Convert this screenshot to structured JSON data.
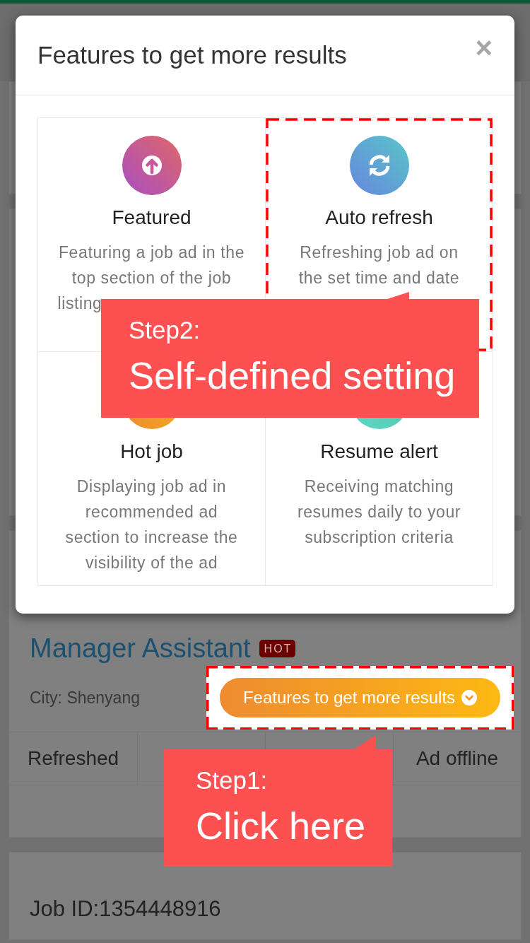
{
  "modal": {
    "title": "Features to get more results",
    "close": "×",
    "features": [
      {
        "title": "Featured",
        "description": "Featuring a job ad in the\ntop section of the job\nlisting",
        "cut_off": true,
        "highlighted": false
      },
      {
        "title": "Auto refresh",
        "description": "Refreshing job ad on\nthe set time and date",
        "cut_off": false,
        "highlighted": true
      },
      {
        "title": "Hot job",
        "description": "Displaying job ad in\nrecommended ad\nsection to increase the\nvisibility of the ad",
        "cut_off": false,
        "highlighted": false
      },
      {
        "title": "Resume alert",
        "description": "Receiving matching\nresumes daily to your\nsubscription criteria",
        "cut_off": false,
        "highlighted": false
      }
    ]
  },
  "job": {
    "title": "Manager Assistant",
    "badge": "HOT",
    "city": "City: Shenyang",
    "features_button": {
      "label": "Features to get more results",
      "highlighted": true
    },
    "actions": [
      {
        "label": "Refreshed"
      },
      {
        "label": "Ad offline"
      }
    ]
  },
  "job_id": "Job ID:1354448916",
  "callouts": [
    {
      "step": "Step2:",
      "text": "Self-defined setting"
    },
    {
      "step": "Step1:",
      "text": "Click here"
    }
  ]
}
